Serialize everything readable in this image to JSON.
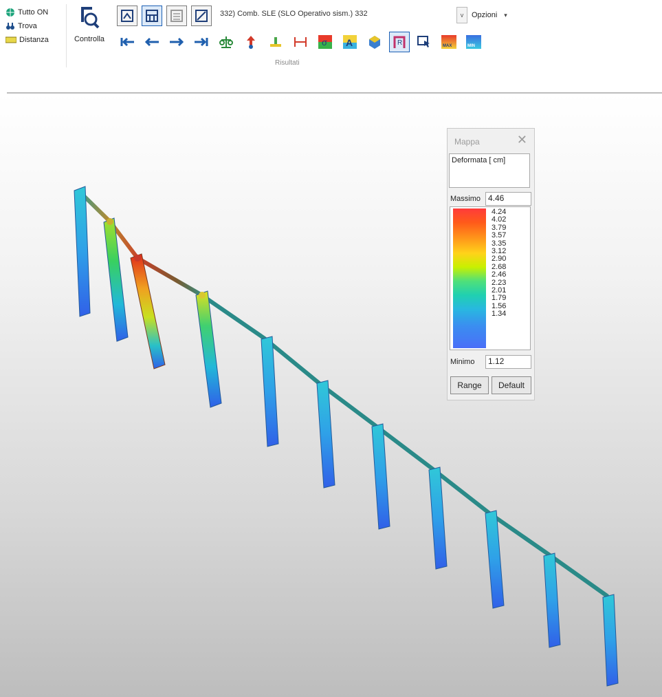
{
  "ribbon": {
    "left_items": [
      {
        "label": "Tutto ON",
        "icon": "globe-icon"
      },
      {
        "label": "Trova",
        "icon": "binoculars-icon"
      },
      {
        "label": "Distanza",
        "icon": "ruler-icon"
      }
    ],
    "controlla_label": "Controlla",
    "combination_label": "332) Comb. SLE (SLO Operativo sism.) 332",
    "group_caption": "Risultati",
    "options_label": "Opzioni",
    "dropdown_glyph": "v",
    "caret_glyph": "▾",
    "max_badge": "MAX",
    "min_badge": "MIN",
    "a_glyph": "A",
    "r_glyph": "R"
  },
  "legend": {
    "title": "Mappa",
    "close_glyph": "✕",
    "description": "Deformata [ cm]",
    "max_label": "Massimo",
    "max_value": "4.46",
    "ticks": [
      "4.24",
      "4.02",
      "3.79",
      "3.57",
      "3.35",
      "3.12",
      "2.90",
      "2.68",
      "2.46",
      "2.23",
      "2.01",
      "1.79",
      "1.56",
      "1.34"
    ],
    "min_label": "Minimo",
    "min_value": "1.12",
    "range_button": "Range",
    "default_button": "Default"
  },
  "colors": {
    "ribbon_selected": "#1b5fb4",
    "column_blue": "#2e7fe0",
    "column_cyan": "#1ec8d8",
    "hot_red": "#e0241a"
  }
}
